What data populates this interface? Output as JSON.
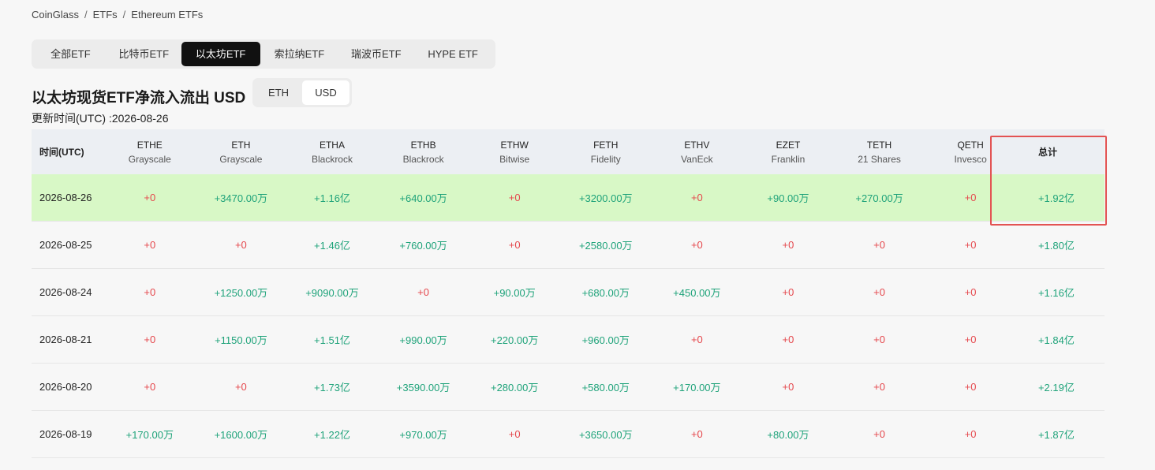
{
  "breadcrumb": [
    "CoinGlass",
    "ETFs",
    "Ethereum ETFs"
  ],
  "tabs": [
    "全部ETF",
    "比特币ETF",
    "以太坊ETF",
    "索拉纳ETF",
    "瑞波币ETF",
    "HYPE ETF"
  ],
  "active_tab": "以太坊ETF",
  "title": "以太坊现货ETF净流入流出 USD",
  "unit_toggle": {
    "options": [
      "ETH",
      "USD"
    ],
    "selected": "USD"
  },
  "updated": "更新时间(UTC) :2026-08-26",
  "table": {
    "date_header": "时间(UTC)",
    "total_header": "总计",
    "columns": [
      {
        "ticker": "ETHE",
        "issuer": "Grayscale"
      },
      {
        "ticker": "ETH",
        "issuer": "Grayscale"
      },
      {
        "ticker": "ETHA",
        "issuer": "Blackrock"
      },
      {
        "ticker": "ETHB",
        "issuer": "Blackrock"
      },
      {
        "ticker": "ETHW",
        "issuer": "Bitwise"
      },
      {
        "ticker": "FETH",
        "issuer": "Fidelity"
      },
      {
        "ticker": "ETHV",
        "issuer": "VanEck"
      },
      {
        "ticker": "EZET",
        "issuer": "Franklin"
      },
      {
        "ticker": "TETH",
        "issuer": "21 Shares"
      },
      {
        "ticker": "QETH",
        "issuer": "Invesco"
      }
    ],
    "rows": [
      {
        "date": "2026-08-26",
        "values": [
          "+0",
          "+3470.00万",
          "+1.16亿",
          "+640.00万",
          "+0",
          "+3200.00万",
          "+0",
          "+90.00万",
          "+270.00万",
          "+0"
        ],
        "total": "+1.92亿"
      },
      {
        "date": "2026-08-25",
        "values": [
          "+0",
          "+0",
          "+1.46亿",
          "+760.00万",
          "+0",
          "+2580.00万",
          "+0",
          "+0",
          "+0",
          "+0"
        ],
        "total": "+1.80亿"
      },
      {
        "date": "2026-08-24",
        "values": [
          "+0",
          "+1250.00万",
          "+9090.00万",
          "+0",
          "+90.00万",
          "+680.00万",
          "+450.00万",
          "+0",
          "+0",
          "+0"
        ],
        "total": "+1.16亿"
      },
      {
        "date": "2026-08-21",
        "values": [
          "+0",
          "+1150.00万",
          "+1.51亿",
          "+990.00万",
          "+220.00万",
          "+960.00万",
          "+0",
          "+0",
          "+0",
          "+0"
        ],
        "total": "+1.84亿"
      },
      {
        "date": "2026-08-20",
        "values": [
          "+0",
          "+0",
          "+1.73亿",
          "+3590.00万",
          "+280.00万",
          "+580.00万",
          "+170.00万",
          "+0",
          "+0",
          "+0"
        ],
        "total": "+2.19亿"
      },
      {
        "date": "2026-08-19",
        "values": [
          "+170.00万",
          "+1600.00万",
          "+1.22亿",
          "+970.00万",
          "+0",
          "+3650.00万",
          "+0",
          "+80.00万",
          "+0",
          "+0"
        ],
        "total": "+1.87亿"
      }
    ],
    "highlighted_row": "2026-08-26"
  },
  "colors": {
    "positive": "#1fa37a",
    "zero": "#e5484d",
    "highlight_row": "#d8f8c6",
    "annotation_box": "#e35353"
  }
}
